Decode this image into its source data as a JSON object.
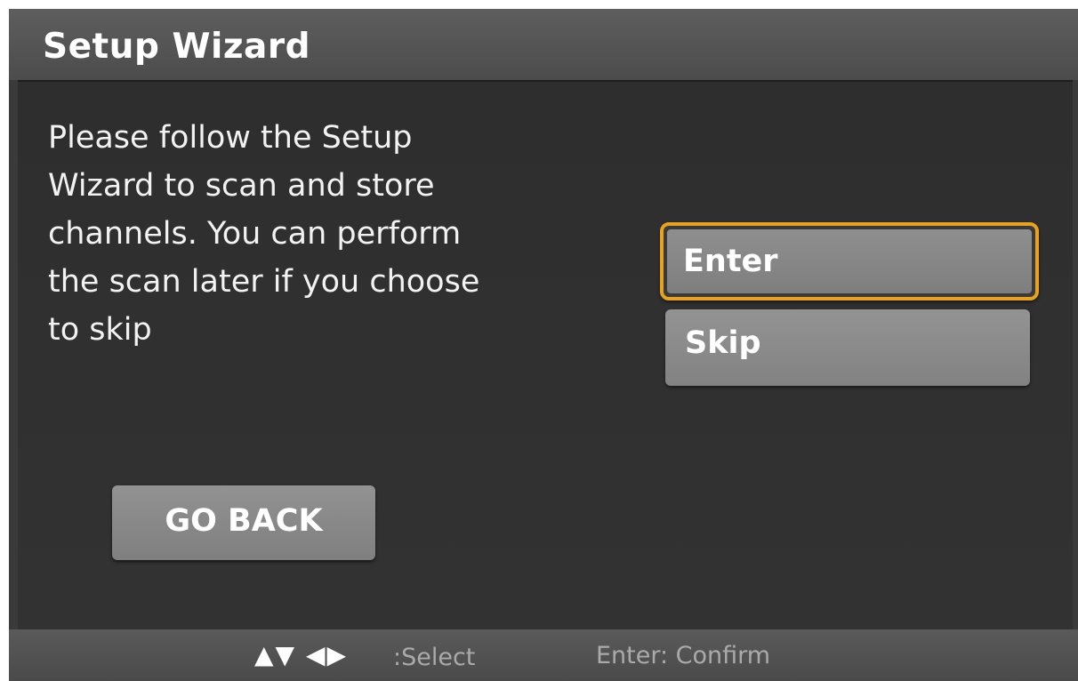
{
  "window": {
    "title": "Setup Wizard"
  },
  "message": "Please follow the Setup\nWizard to scan and store\nchannels.  You can perform\nthe scan later if you choose\nto skip",
  "options": [
    {
      "label": "Enter",
      "focused": true
    },
    {
      "label": "Skip",
      "focused": false
    }
  ],
  "go_back": {
    "label": "GO BACK"
  },
  "footer": {
    "nav_arrows": "▲▼ ◀▶",
    "select_hint": ":Select",
    "confirm_hint": "Enter: Confirm"
  },
  "colors": {
    "focus_border": "#e8a21e",
    "background": "#3a3a3a",
    "button": "#8a8a8a"
  }
}
